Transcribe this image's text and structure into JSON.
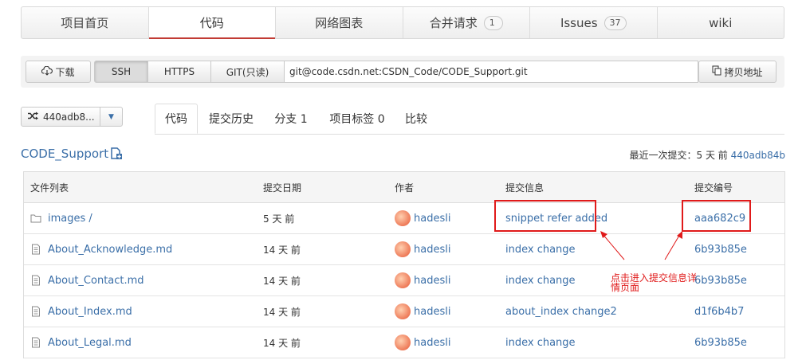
{
  "topnav": {
    "items": [
      {
        "label": "项目首页"
      },
      {
        "label": "代码"
      },
      {
        "label": "网络图表"
      },
      {
        "label": "合并请求",
        "badge": "1"
      },
      {
        "label": "Issues",
        "badge": "37"
      },
      {
        "label": "wiki"
      }
    ],
    "active_index": 1,
    "accent_color": "#c23b34"
  },
  "clone": {
    "download_label": "下载",
    "ssh_label": "SSH",
    "https_label": "HTTPS",
    "git_label": "GIT(只读)",
    "url": "git@code.csdn.net:CSDN_Code/CODE_Support.git",
    "copy_label": "拷贝地址"
  },
  "branch": {
    "label": "440adb8..."
  },
  "subtabs": [
    {
      "label": "代码"
    },
    {
      "label": "提交历史"
    },
    {
      "label": "分支 1"
    },
    {
      "label": "项目标签 0"
    },
    {
      "label": "比较"
    }
  ],
  "repo": {
    "name": "CODE_Support",
    "latest_prefix": "最近一次提交：5 天 前",
    "latest_hash": "440adb84b"
  },
  "table": {
    "headers": {
      "name": "文件列表",
      "date": "提交日期",
      "author": "作者",
      "message": "提交信息",
      "hash": "提交编号"
    },
    "rows": [
      {
        "name": "images /",
        "type": "folder",
        "date": "5 天 前",
        "author": "hadesli",
        "message": "snippet refer added",
        "hash": "aaa682c9"
      },
      {
        "name": "About_Acknowledge.md",
        "type": "file",
        "date": "14 天 前",
        "author": "hadesli",
        "message": "index change",
        "hash": "6b93b85e"
      },
      {
        "name": "About_Contact.md",
        "type": "file",
        "date": "14 天 前",
        "author": "hadesli",
        "message": "index change",
        "hash": "6b93b85e"
      },
      {
        "name": "About_Index.md",
        "type": "file",
        "date": "14 天 前",
        "author": "hadesli",
        "message": "about_index change2",
        "hash": "d1f6b4b7"
      },
      {
        "name": "About_Legal.md",
        "type": "file",
        "date": "14 天 前",
        "author": "hadesli",
        "message": "index change",
        "hash": "6b93b85e"
      }
    ]
  },
  "annotation": {
    "text": "点击进入提交信息详情页面",
    "color": "#e01a1a"
  }
}
